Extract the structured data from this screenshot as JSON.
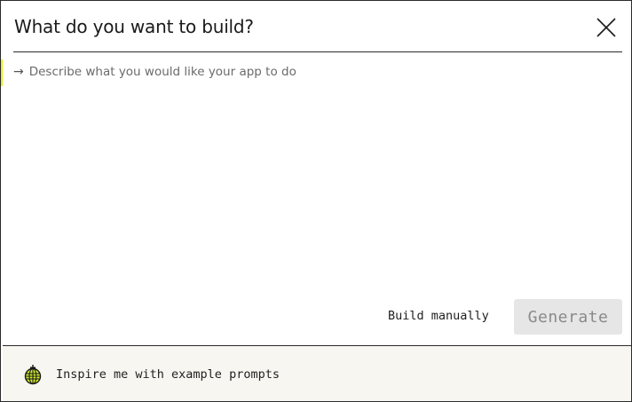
{
  "dialog": {
    "title": "What do you want to build?",
    "close_icon": "close-icon"
  },
  "prompt": {
    "arrow": "→",
    "placeholder": "Describe what you would like your app to do",
    "value": ""
  },
  "actions": {
    "build_manually_label": "Build manually",
    "generate_label": "Generate"
  },
  "footer": {
    "inspire_icon": "disco-ball-icon",
    "inspire_label": "Inspire me with example prompts"
  },
  "colors": {
    "accent": "#e3f21a",
    "border": "#2b2b2b",
    "footer_bg": "#f7f6f1",
    "disabled_button_bg": "#e6e6e6"
  }
}
